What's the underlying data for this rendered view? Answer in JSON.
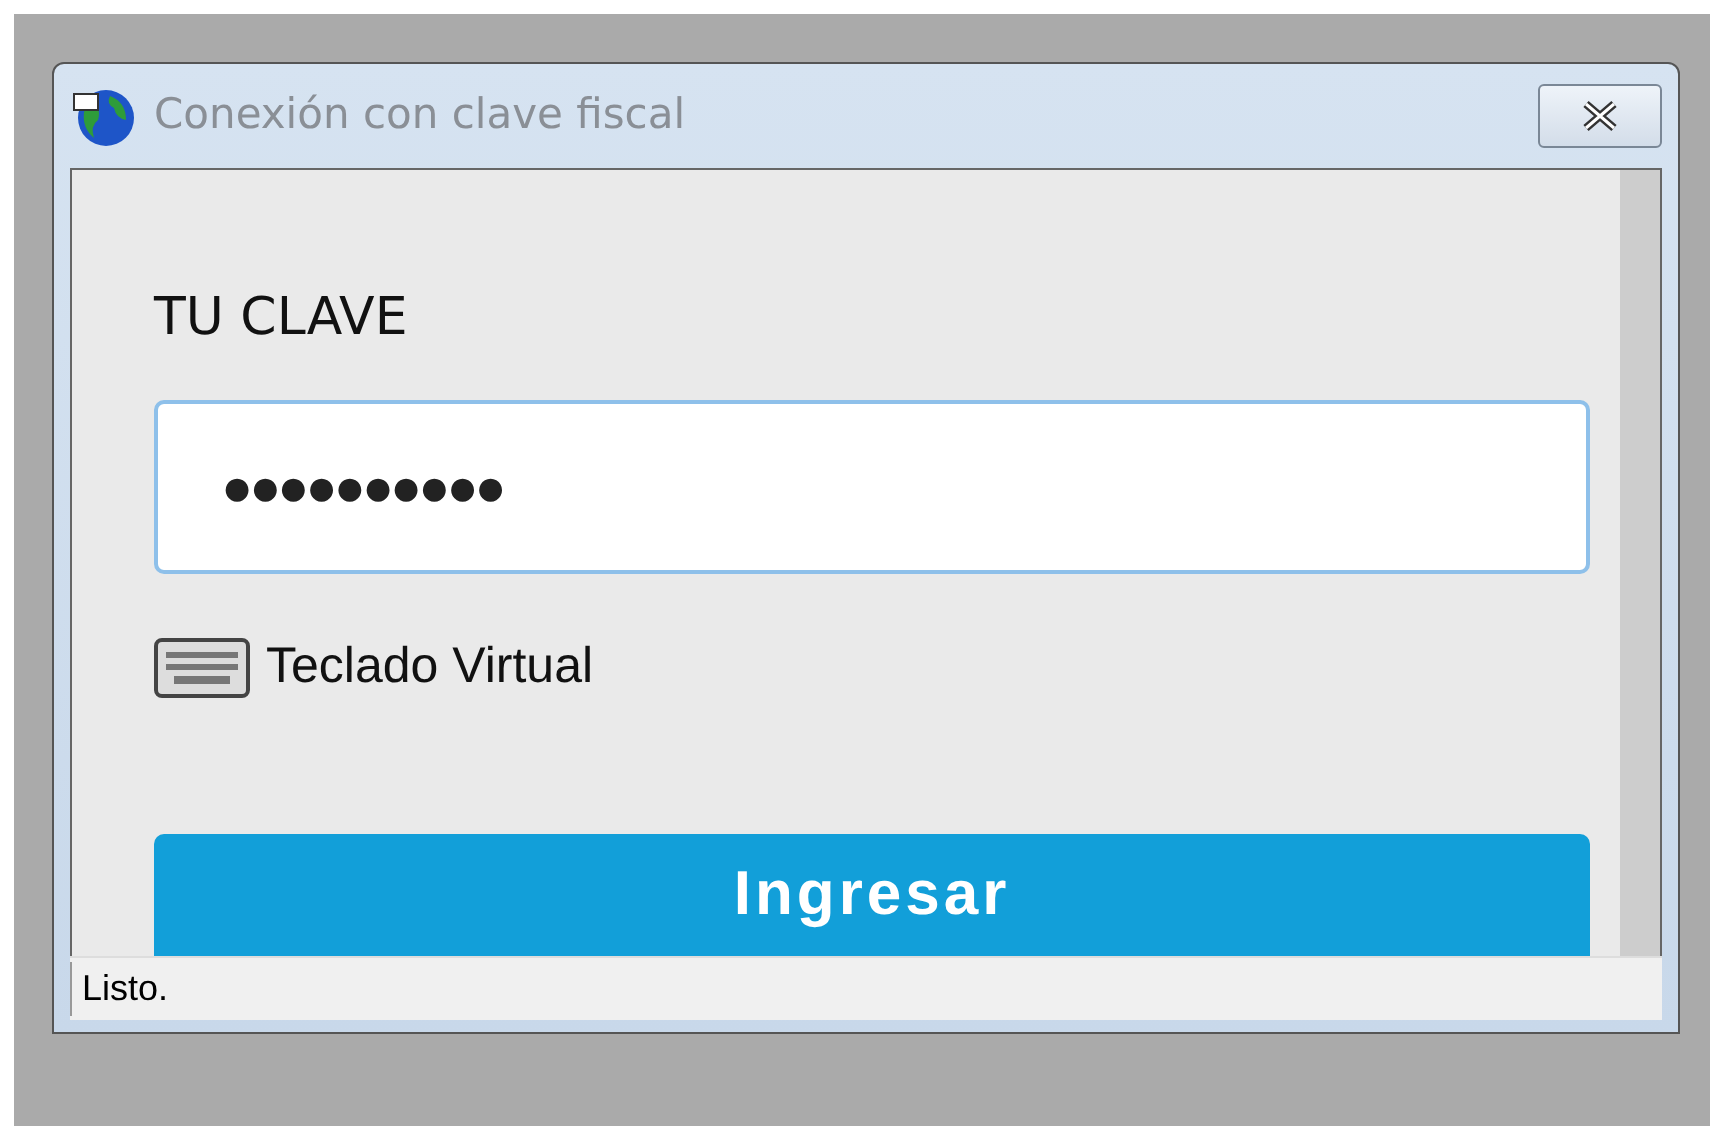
{
  "window": {
    "title": "Conexión con clave fiscal"
  },
  "form": {
    "label": "TU CLAVE",
    "password": "●●●●●●●●●●",
    "keyboard_link": "Teclado Virtual",
    "submit": "Ingresar"
  },
  "status_bar": "Listo."
}
